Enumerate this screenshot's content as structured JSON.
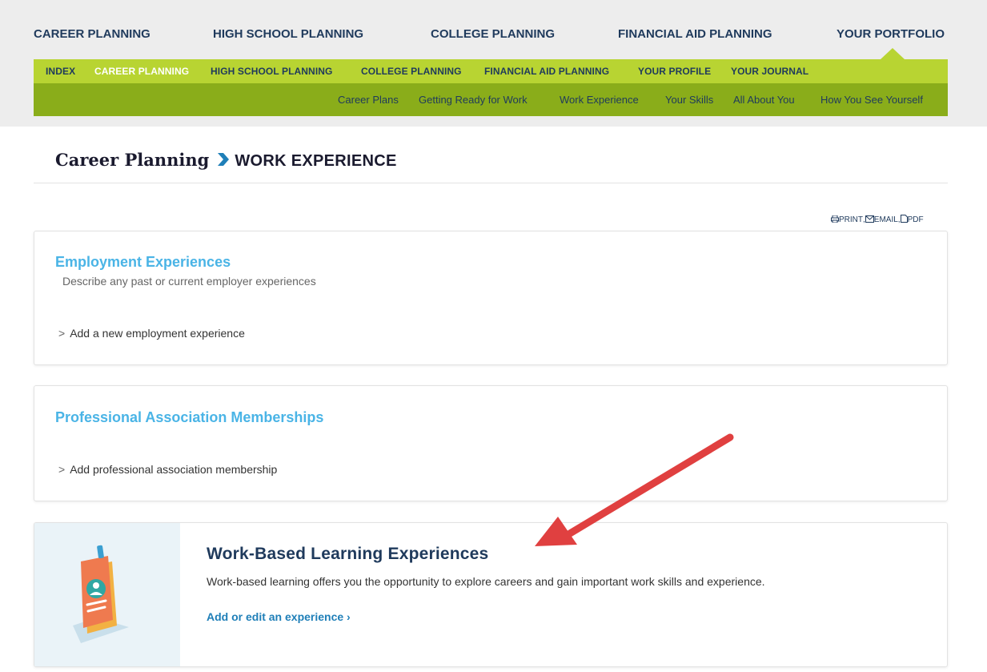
{
  "main_nav": {
    "items": [
      {
        "label": "CAREER PLANNING"
      },
      {
        "label": "HIGH SCHOOL PLANNING"
      },
      {
        "label": "COLLEGE PLANNING"
      },
      {
        "label": "FINANCIAL AID PLANNING"
      },
      {
        "label": "YOUR PORTFOLIO"
      }
    ]
  },
  "sub_nav": {
    "items": [
      {
        "label": "INDEX"
      },
      {
        "label": "CAREER PLANNING",
        "active": true
      },
      {
        "label": "HIGH SCHOOL PLANNING"
      },
      {
        "label": "COLLEGE PLANNING"
      },
      {
        "label": "FINANCIAL AID PLANNING"
      },
      {
        "label": "YOUR PROFILE"
      },
      {
        "label": "YOUR JOURNAL"
      }
    ]
  },
  "tert_nav": {
    "items": [
      {
        "label": "Career Plans"
      },
      {
        "label": "Getting Ready for Work"
      },
      {
        "label": "Work Experience"
      },
      {
        "label": "Your Skills"
      },
      {
        "label": "All About You"
      },
      {
        "label": "How You See Yourself"
      }
    ]
  },
  "breadcrumb": {
    "parent": "Career Planning",
    "current": "WORK EXPERIENCE"
  },
  "tools": {
    "print": "PRINT",
    "email": "EMAIL",
    "pdf": "PDF",
    "sep": ","
  },
  "employment": {
    "title": "Employment Experiences",
    "description": "Describe any past or current employer experiences",
    "add_link": "Add a new employment experience",
    "chevron": ">"
  },
  "associations": {
    "title": "Professional Association Memberships",
    "add_link": "Add professional association membership",
    "chevron": ">"
  },
  "work_based": {
    "title": "Work-Based Learning Experiences",
    "description": "Work-based learning offers you the opportunity to explore careers and gain important work skills and experience.",
    "edit_link": "Add or edit an experience  ›"
  },
  "colors": {
    "subnav_bg": "#b8d432",
    "tertnav_bg": "#8aad1a",
    "accent_blue": "#4ab4e6",
    "navy": "#1f3a5c",
    "arrow_red": "#e04040"
  },
  "icons": [
    "chevron-right-icon",
    "print-icon",
    "email-icon",
    "pdf-icon",
    "id-badge-icon",
    "annotation-arrow"
  ]
}
